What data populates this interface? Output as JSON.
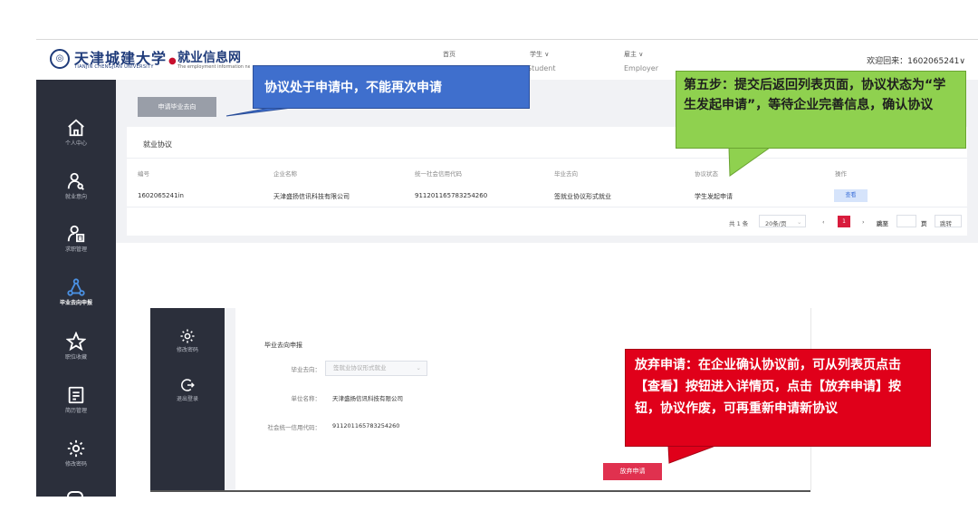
{
  "header": {
    "brand": "天津城建大学",
    "brand_en": "TIANJIN CHENGJIAN UNIVERSITY",
    "portal_title": "就业信息网",
    "portal_sub": "The employment information ne",
    "nav": [
      {
        "label": "首页",
        "en": ""
      },
      {
        "label": "学生 ∨",
        "en": "Student"
      },
      {
        "label": "雇主 ∨",
        "en": "Employer"
      }
    ],
    "welcome": "欢迎回来：1602065241∨"
  },
  "sidebar": {
    "items": [
      {
        "label": "个人中心",
        "icon": "home-icon"
      },
      {
        "label": "就业意向",
        "icon": "user-search-icon"
      },
      {
        "label": "求职管理",
        "icon": "job-manage-icon"
      },
      {
        "label": "毕业去向申报",
        "icon": "network-icon",
        "active": true
      },
      {
        "label": "职位收藏",
        "icon": "star-icon"
      },
      {
        "label": "简历管理",
        "icon": "resume-icon"
      },
      {
        "label": "修改密码",
        "icon": "gear-icon"
      }
    ]
  },
  "main": {
    "apply_button": "申请毕业去向",
    "card_title": "就业协议",
    "table": {
      "headers": [
        "编号",
        "企业名称",
        "统一社会信用代码",
        "毕业去向",
        "协议状态",
        "操作"
      ],
      "rows": [
        [
          "1602065241in",
          "天津盛扬信讯科技有限公司",
          "911201165783254260",
          "签就业协议形式就业",
          "学生发起申请",
          "查看"
        ]
      ]
    },
    "pagination": {
      "total": "共 1 条",
      "page_size": "20条/页",
      "current_page": "1",
      "goto_label": "跳至",
      "page_unit": "页",
      "confirm": "跳转"
    }
  },
  "callouts": {
    "blue": "协议处于申请中，不能再次申请",
    "green": "第五步：提交后返回列表页面，协议状态为“学生发起申请”，等待企业完善信息，确认协议",
    "red": "放弃申请：在企业确认协议前，可从列表页点击【查看】按钮进入详情页，点击【放弃申请】按钮，协议作废，可再重新申请新协议"
  },
  "inset": {
    "side_items": [
      {
        "label": "修改密码",
        "icon": "gear-icon"
      },
      {
        "label": "退出登录",
        "icon": "logout-icon"
      }
    ],
    "title": "毕业去向申报",
    "fields": [
      {
        "label": "毕业去向：",
        "value": "签就业协议形式就业"
      },
      {
        "label": "单位名称：",
        "value": "天津盛扬信讯科技有限公司"
      },
      {
        "label": "社会统一信用代码：",
        "value": "911201165783254260"
      }
    ],
    "abandon_button": "放弃申请"
  },
  "colors": {
    "sidebar_bg": "#2b2f3b",
    "brand_blue": "#1f3b7a",
    "callout_blue": "#3f6fcd",
    "callout_green": "#8fd14f",
    "callout_red": "#e0001a",
    "accent_red": "#d81b3c"
  }
}
